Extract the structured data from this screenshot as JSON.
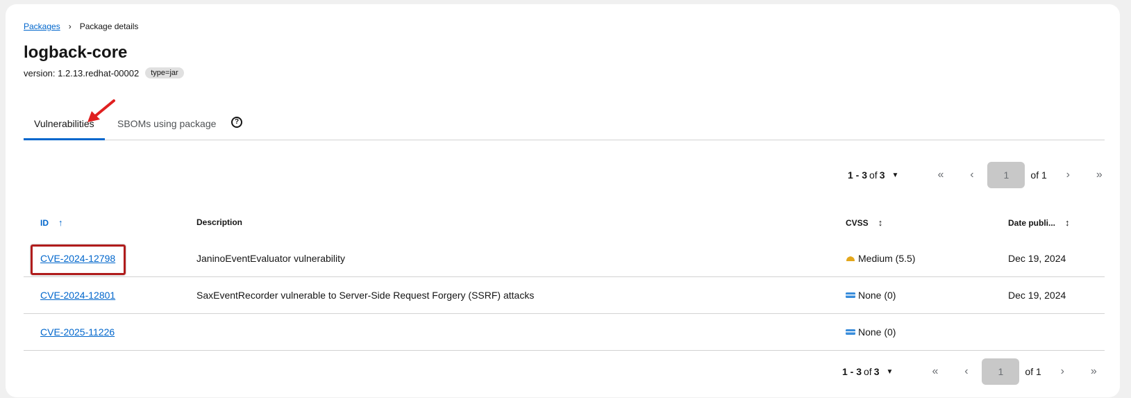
{
  "breadcrumb": {
    "parent": "Packages",
    "separator": "›",
    "current": "Package details"
  },
  "title": "logback-core",
  "version_line": "version: 1.2.13.redhat-00002",
  "type_badge": "type=jar",
  "tabs": [
    {
      "label": "Vulnerabilities",
      "active": true
    },
    {
      "label": "SBOMs using package",
      "active": false
    }
  ],
  "help_icon": "?",
  "pagination": {
    "range": "1 - 3",
    "of": "of",
    "total": "3",
    "page": "1",
    "of_pages": "of 1"
  },
  "table": {
    "columns": [
      "ID",
      "Description",
      "CVSS",
      "Date publi..."
    ],
    "rows": [
      {
        "id": "CVE-2024-12798",
        "description": "JaninoEventEvaluator vulnerability",
        "cvss": "Medium (5.5)",
        "severity": "medium",
        "date": "Dec 19, 2024"
      },
      {
        "id": "CVE-2024-12801",
        "description": "SaxEventRecorder vulnerable to Server-Side Request Forgery (SSRF) attacks",
        "cvss": "None (0)",
        "severity": "none",
        "date": "Dec 19, 2024"
      },
      {
        "id": "CVE-2025-11226",
        "description": "",
        "cvss": "None (0)",
        "severity": "none",
        "date": ""
      }
    ]
  },
  "colors": {
    "link": "#0066cc",
    "medium": "#e3a71c",
    "none": "#3a8ddb",
    "annotation": "#b01c1c",
    "arrow": "#e02020"
  }
}
